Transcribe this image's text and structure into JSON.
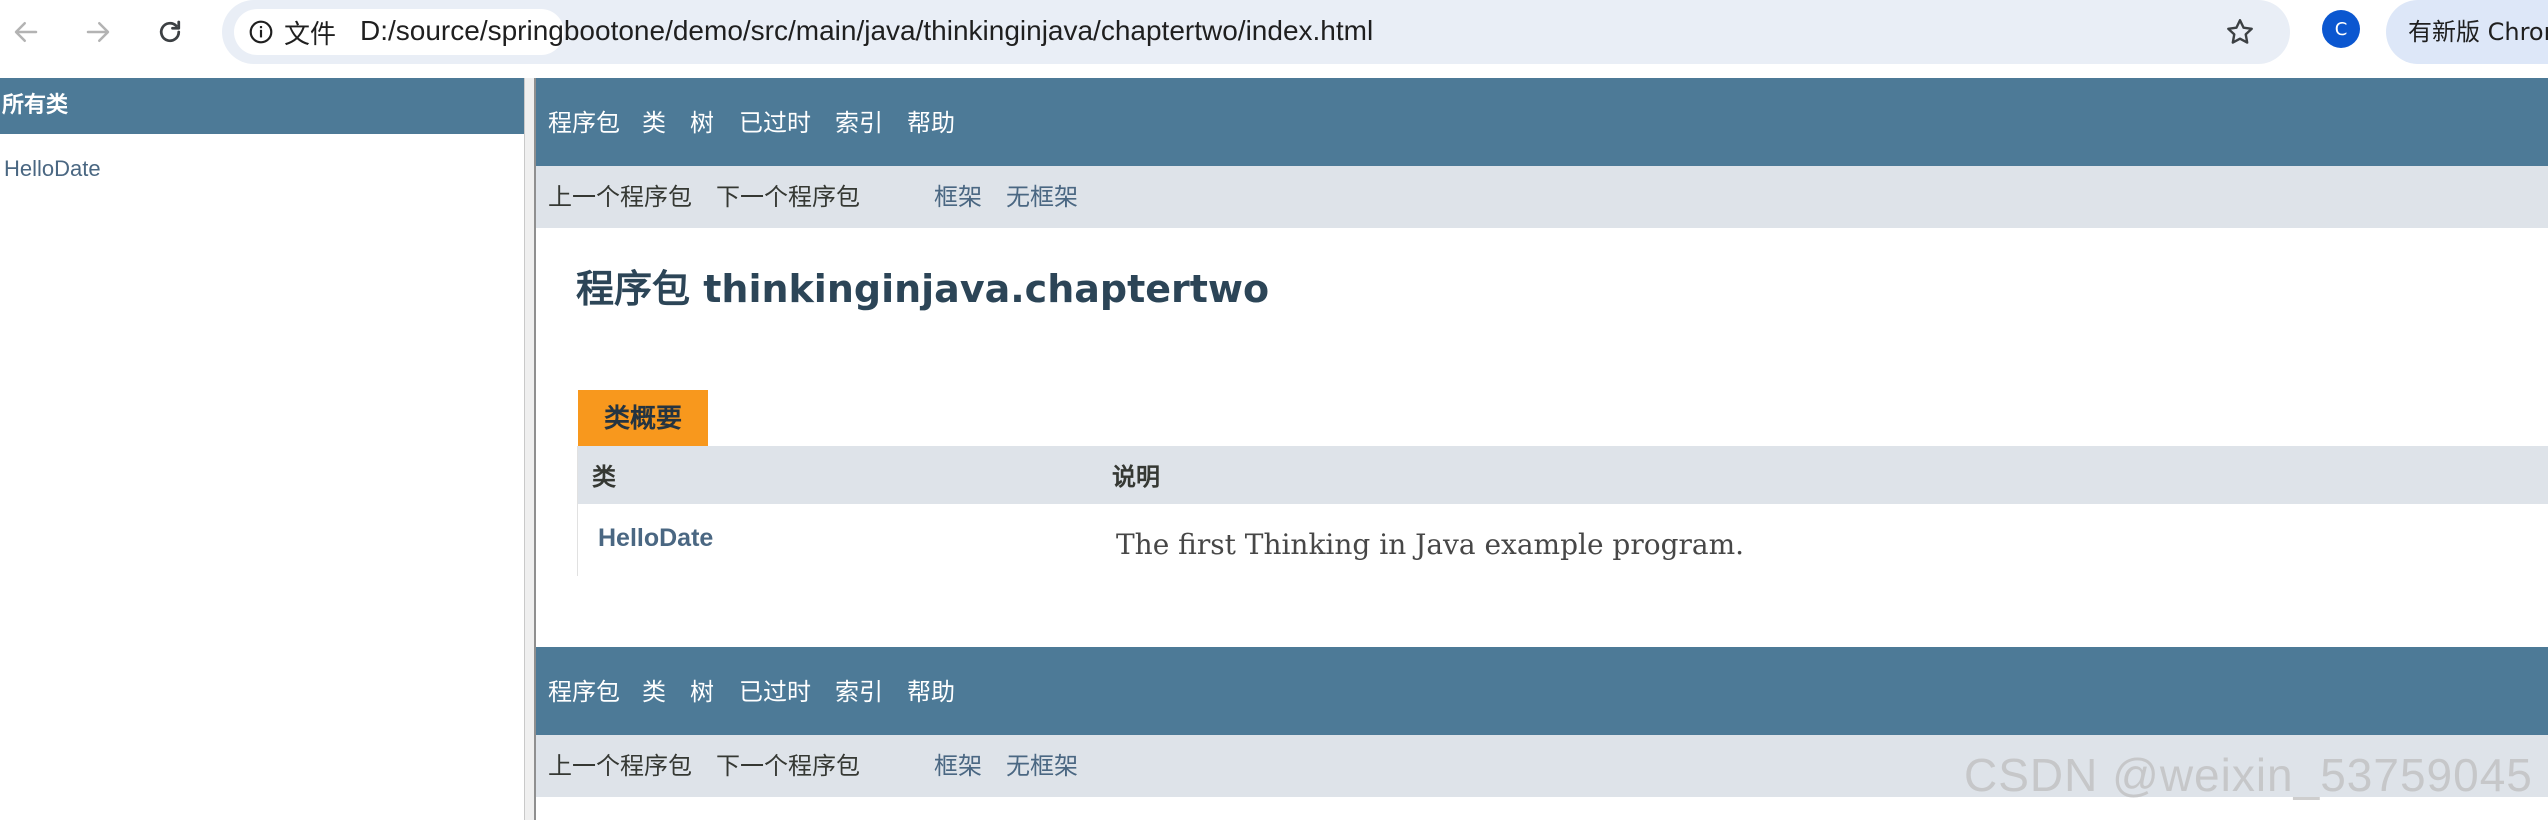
{
  "browser": {
    "site_info_label": "文件",
    "url": "D:/source/springbootone/demo/src/main/java/thinkinginjava/chaptertwo/index.html",
    "profile_initial": "C",
    "update_chip_label": "有新版 Chrome"
  },
  "left_frame": {
    "title": "所有类",
    "classes": [
      "HelloDate"
    ]
  },
  "top_nav": {
    "items": [
      "程序包",
      "类",
      "树",
      "已过时",
      "索引",
      "帮助"
    ]
  },
  "sub_nav": {
    "prev_package": "上一个程序包",
    "next_package": "下一个程序包",
    "frames": "框架",
    "no_frames": "无框架"
  },
  "main": {
    "package_title": "程序包 thinkinginjava.chaptertwo",
    "summary_caption": "类概要",
    "table_headers": [
      "类",
      "说明"
    ],
    "table_rows": [
      {
        "class": "HelloDate",
        "description": "The first Thinking in Java example program."
      }
    ]
  },
  "watermark": "CSDN @weixin_53759045",
  "colors": {
    "nav_bar": "#4d7a97",
    "sub_nav": "#dee3e9",
    "caption_accent": "#f8981d",
    "link": "#4a6782",
    "title": "#2c4557"
  },
  "icons": [
    "back-arrow-icon",
    "forward-arrow-icon",
    "reload-icon",
    "info-icon",
    "star-icon"
  ]
}
